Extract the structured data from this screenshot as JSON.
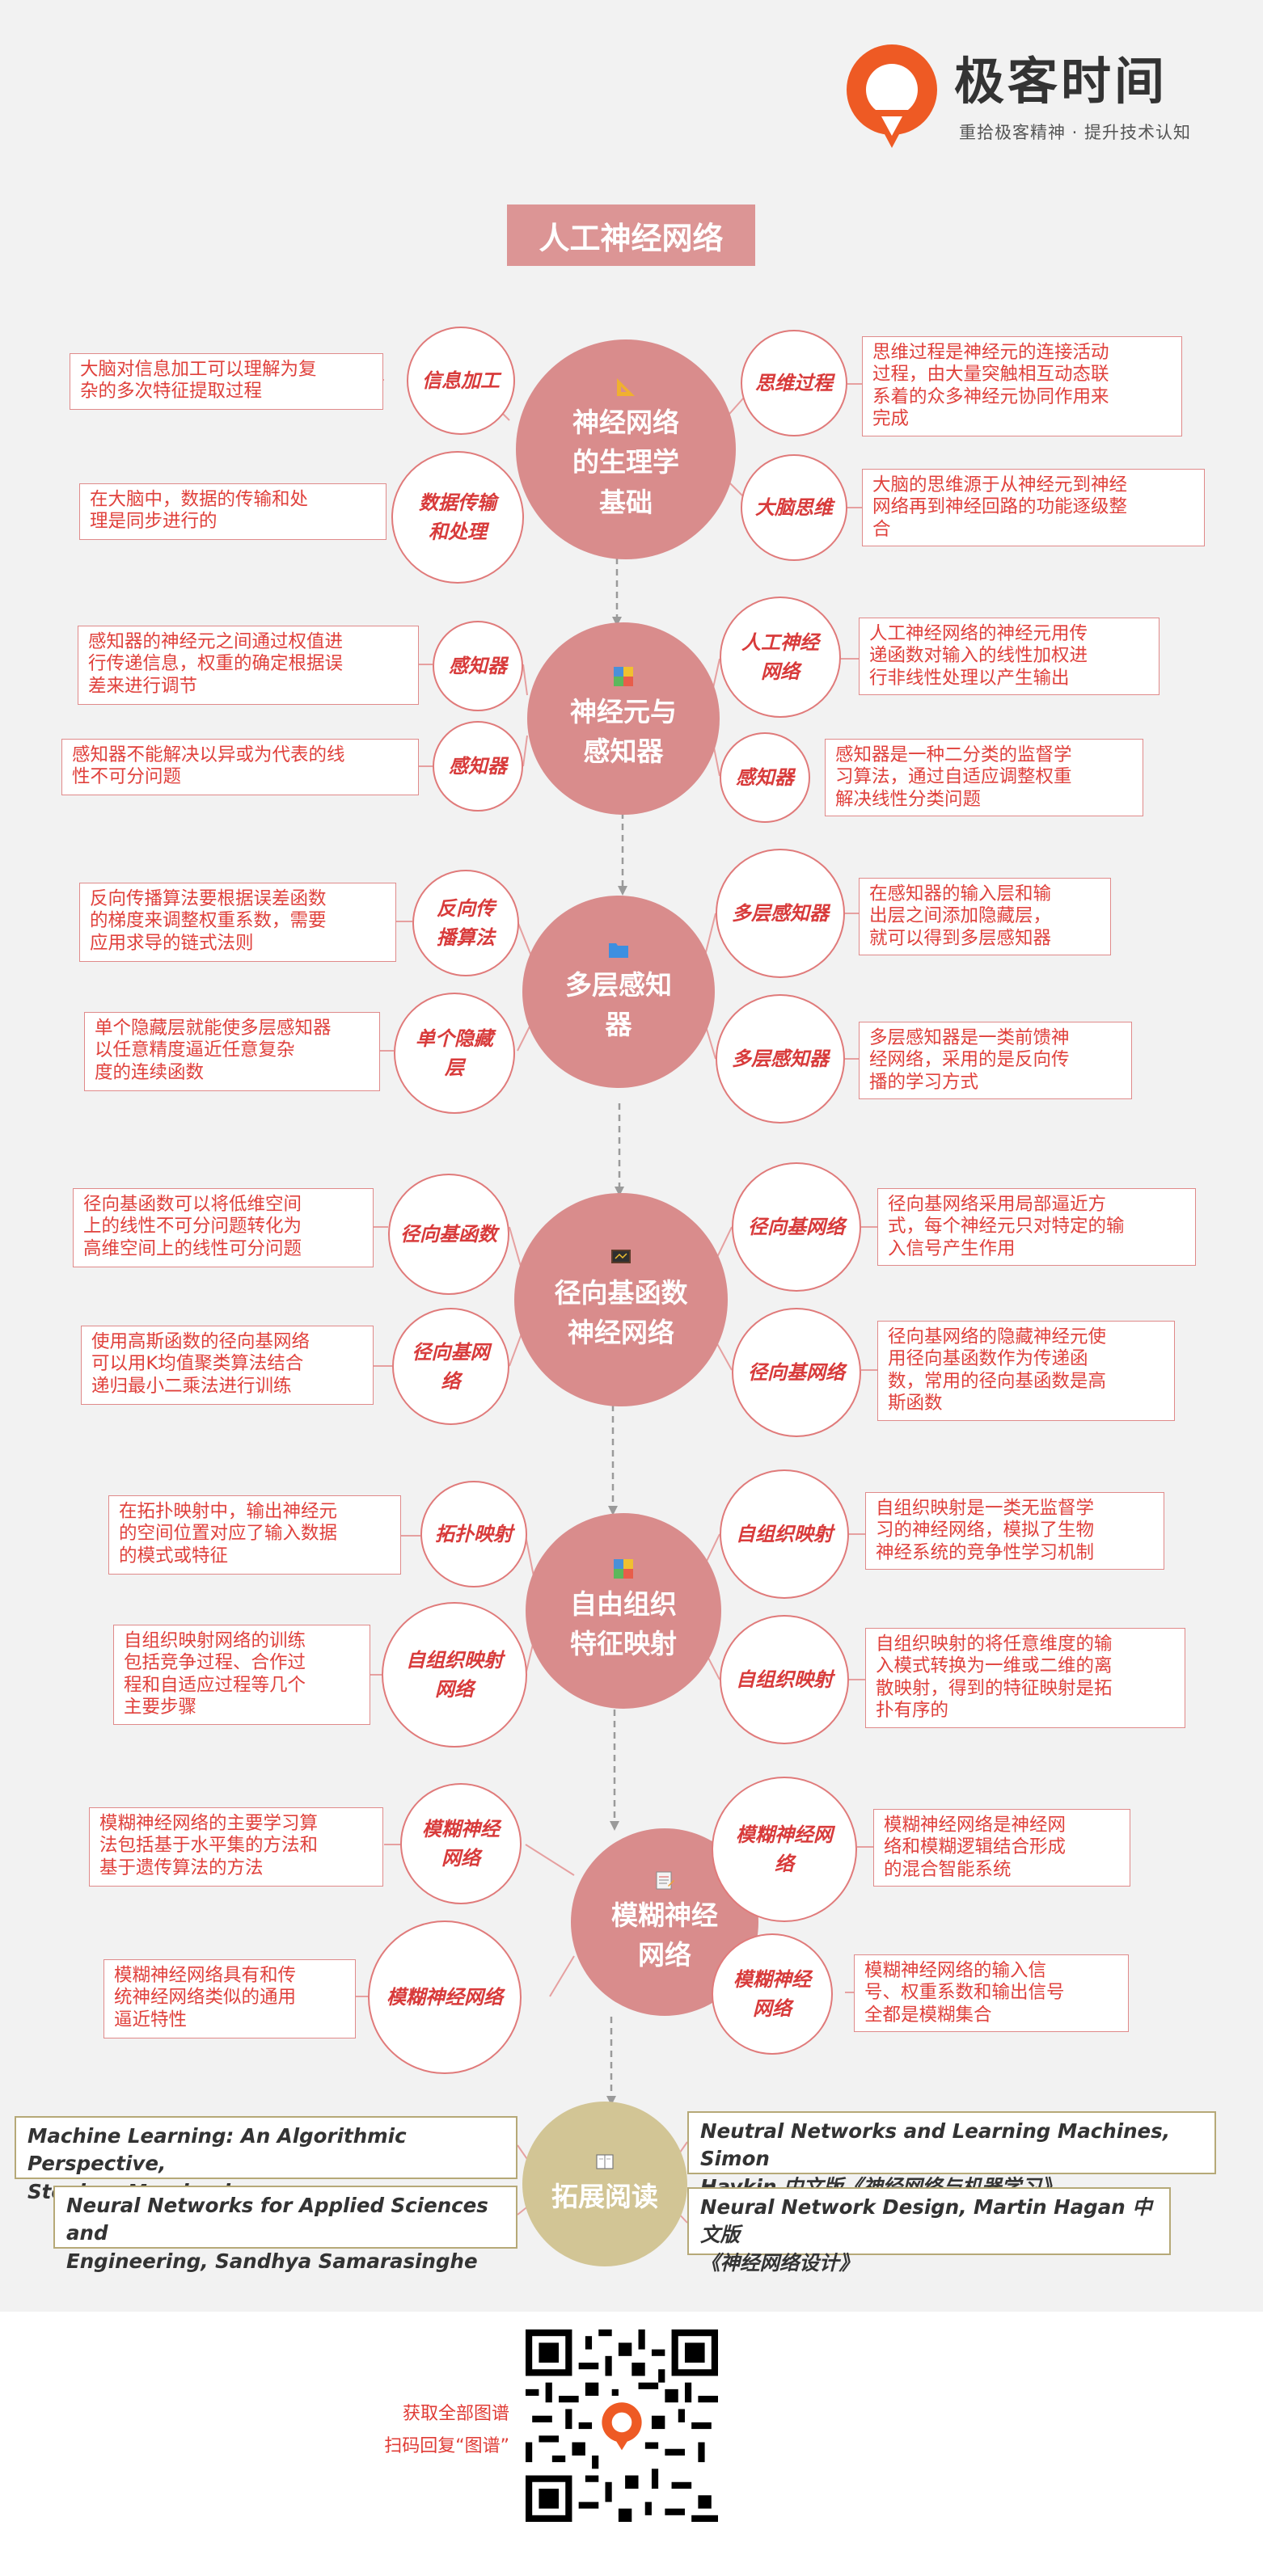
{
  "brand": {
    "name": "极客时间",
    "slogan": "重拾极客精神 · 提升技术认知",
    "accent": "#e8531f"
  },
  "title": "人工神经网络",
  "colors": {
    "hub": "#d98c8c",
    "hub_ext": "#d2c595",
    "node_border": "#e07a7a",
    "text_red": "#d83b3b"
  },
  "sections": [
    {
      "hub": "神经网络\n的生理学\n基础",
      "icon": "triangle-ruler-icon",
      "nodes": [
        {
          "label": "信息加工",
          "desc": "大脑对信息加工可以理解为复\n杂的多次特征提取过程"
        },
        {
          "label": "数据传输\n和处理",
          "desc": "在大脑中，数据的传输和处\n理是同步进行的"
        },
        {
          "label": "思维过程",
          "desc": "思维过程是神经元的连接活动\n过程，由大量突触相互动态联\n系着的众多神经元协同作用来\n完成"
        },
        {
          "label": "大脑思维",
          "desc": "大脑的思维源于从神经元到神经\n网络再到神经回路的功能逐级整\n合"
        }
      ]
    },
    {
      "hub": "神经元与\n感知器",
      "icon": "color-blocks-icon",
      "nodes": [
        {
          "label": "感知器",
          "desc": "感知器的神经元之间通过权值进\n行传递信息，权重的确定根据误\n差来进行调节"
        },
        {
          "label": "感知器",
          "desc": "感知器不能解决以异或为代表的线\n性不可分问题"
        },
        {
          "label": "人工神经\n网络",
          "desc": "人工神经网络的神经元用传\n递函数对输入的线性加权进\n行非线性处理以产生输出"
        },
        {
          "label": "感知器",
          "desc": "感知器是一种二分类的监督学\n习算法，通过自适应调整权重\n解决线性分类问题"
        }
      ]
    },
    {
      "hub": "多层感知\n器",
      "icon": "folder-icon",
      "nodes": [
        {
          "label": "反向传\n播算法",
          "desc": "反向传播算法要根据误差函数\n的梯度来调整权重系数，需要\n应用求导的链式法则"
        },
        {
          "label": "单个隐藏\n层",
          "desc": "单个隐藏层就能使多层感知器\n以任意精度逼近任意复杂\n度的连续函数"
        },
        {
          "label": "多层感知器",
          "desc": "在感知器的输入层和输\n出层之间添加隐藏层，\n就可以得到多层感知器"
        },
        {
          "label": "多层感知器",
          "desc": "多层感知器是一类前馈神\n经网络，采用的是反向传\n播的学习方式"
        }
      ]
    },
    {
      "hub": "径向基函数\n神经网络",
      "icon": "blackboard-icon",
      "nodes": [
        {
          "label": "径向基函数",
          "desc": "径向基函数可以将低维空间\n上的线性不可分问题转化为\n高维空间上的线性可分问题"
        },
        {
          "label": "径向基网\n络",
          "desc": "使用高斯函数的径向基网络\n可以用K均值聚类算法结合\n递归最小二乘法进行训练"
        },
        {
          "label": "径向基网络",
          "desc": "径向基网络采用局部逼近方\n式，每个神经元只对特定的输\n入信号产生作用"
        },
        {
          "label": "径向基网络",
          "desc": "径向基网络的隐藏神经元使\n用径向基函数作为传递函\n数，常用的径向基函数是高\n斯函数"
        }
      ]
    },
    {
      "hub": "自由组织\n特征映射",
      "icon": "color-blocks-icon",
      "nodes": [
        {
          "label": "拓扑映射",
          "desc": "在拓扑映射中，输出神经元\n的空间位置对应了输入数据\n的模式或特征"
        },
        {
          "label": "自组织映射\n网络",
          "desc": "自组织映射网络的训练\n包括竞争过程、合作过\n程和自适应过程等几个\n主要步骤"
        },
        {
          "label": "自组织映射",
          "desc": "自组织映射是一类无监督学\n习的神经网络，模拟了生物\n神经系统的竞争性学习机制"
        },
        {
          "label": "自组织映射",
          "desc": "自组织映射的将任意维度的输\n入模式转换为一维或二维的离\n散映射，得到的特征映射是拓\n扑有序的"
        }
      ]
    },
    {
      "hub": "模糊神经\n网络",
      "icon": "notepad-icon",
      "nodes": [
        {
          "label": "模糊神经\n网络",
          "desc": "模糊神经网络的主要学习算\n法包括基于水平集的方法和\n基于遗传算法的方法"
        },
        {
          "label": "模糊神经网络",
          "desc": "模糊神经网络具有和传\n统神经网络类似的通用\n逼近特性"
        },
        {
          "label": "模糊神经网\n络",
          "desc": "模糊神经网络是神经网\n络和模糊逻辑结合形成\n的混合智能系统"
        },
        {
          "label": "模糊神经\n网络",
          "desc": "模糊神经网络的输入信\n号、权重系数和输出信号\n全都是模糊集合"
        }
      ]
    }
  ],
  "extended": {
    "hub": "拓展阅读",
    "icon": "book-icon",
    "books": [
      "Machine Learning: An Algorithmic Perspective,\nStephen Marsland",
      "Neural  Networks for Applied Sciences and\nEngineering, Sandhya Samarasinghe",
      "Neutral Networks and Learning Machines, Simon\nHaykin 中文版《神经网络与机器学习》",
      "Neural Network Design, Martin Hagan 中文版\n《神经网络设计》"
    ]
  },
  "footer": {
    "line1": "获取全部图谱",
    "line2": "扫码回复“图谱”"
  }
}
